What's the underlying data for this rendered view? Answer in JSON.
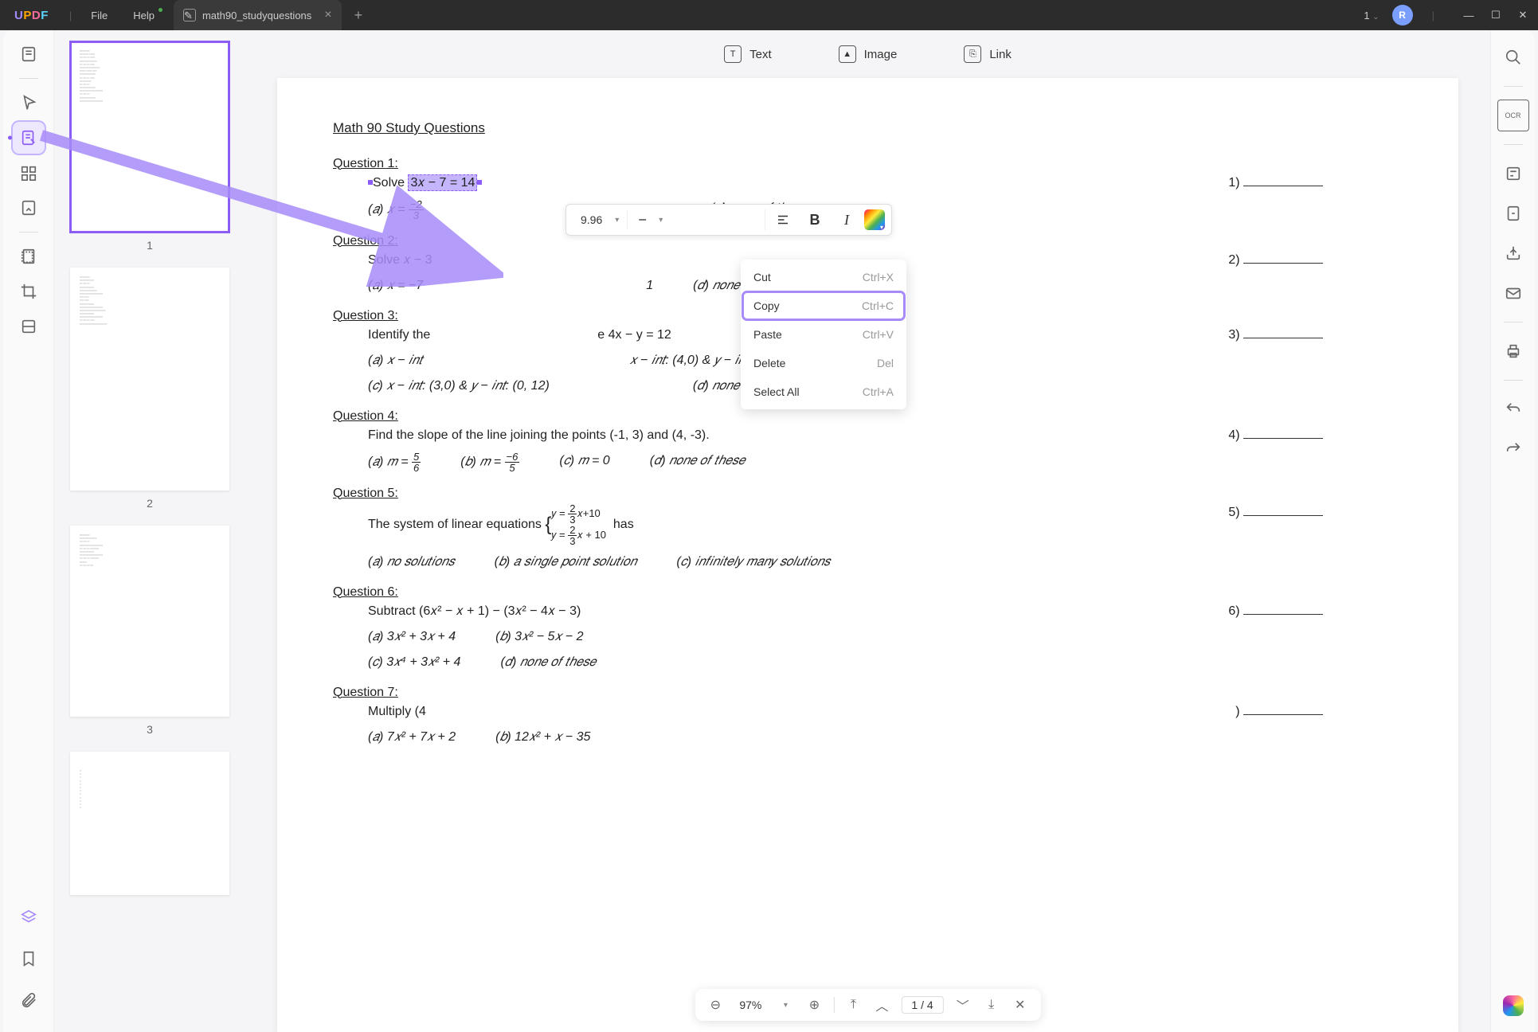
{
  "app": {
    "name": "UPDF"
  },
  "menus": {
    "file": "File",
    "help": "Help"
  },
  "tab": {
    "title": "math90_studyquestions"
  },
  "titlebar": {
    "page_indicator": "1"
  },
  "avatar": {
    "initial": "R"
  },
  "top_tools": {
    "text": "Text",
    "image": "Image",
    "link": "Link"
  },
  "edit_toolbar": {
    "font_size": "9.96",
    "font_family": "–",
    "bold": "B",
    "italic": "I"
  },
  "context_menu": {
    "items": [
      {
        "label": "Cut",
        "shortcut": "Ctrl+X"
      },
      {
        "label": "Copy",
        "shortcut": "Ctrl+C",
        "highlighted": true
      },
      {
        "label": "Paste",
        "shortcut": "Ctrl+V"
      },
      {
        "label": "Delete",
        "shortcut": "Del"
      },
      {
        "label": "Select All",
        "shortcut": "Ctrl+A"
      }
    ]
  },
  "thumbs": {
    "p1": "1",
    "p2": "2",
    "p3": "3"
  },
  "document": {
    "title": "Math 90 Study Questions",
    "q1": {
      "label": "Question 1:",
      "prompt": "Solve",
      "expr": "3𝑥 − 7 = 14",
      "num": "1)",
      "a": "(𝑎)   𝑥 = ",
      "d": "(𝑑)   𝑛𝑜𝑛𝑒 𝑜𝑓 𝑡ℎ𝑒𝑠𝑒"
    },
    "q2": {
      "label": "Question 2:",
      "prompt": "Solve  𝑥 − 3",
      "num": "2)",
      "a": "(𝑎)   𝑥 = −7",
      "bnum": "1",
      "d": "(𝑑)   𝑛𝑜𝑛𝑒 𝑜𝑓 𝑡ℎ𝑒𝑠𝑒"
    },
    "q3": {
      "label": "Question 3:",
      "prompt": "Identify the",
      "promptb": "e 4x − y = 12",
      "num": "3)",
      "a": "(𝑎)   𝑥 − 𝑖𝑛𝑡",
      "b": "𝑥 − 𝑖𝑛𝑡: (4,0) & 𝑦 − 𝑖𝑛𝑡: (0, −1)",
      "c": "(𝑐)   𝑥 − 𝑖𝑛𝑡: (3,0) & 𝑦 − 𝑖𝑛𝑡: (0, 12)",
      "d": "(𝑑)   𝑛𝑜𝑛𝑒 𝑜𝑓 𝑡ℎ𝑒𝑠𝑒"
    },
    "q4": {
      "label": "Question 4:",
      "prompt": "Find the slope of the line joining the points (-1, 3) and (4, -3).",
      "num": "4)",
      "a": "(𝑎)   𝑚 = ",
      "b": "(𝑏)   𝑚 = ",
      "c": "(𝑐)   𝑚 = 0",
      "d": "(𝑑)   𝑛𝑜𝑛𝑒 𝑜𝑓 𝑡ℎ𝑒𝑠𝑒"
    },
    "q5": {
      "label": "Question 5:",
      "prompta": "The system of linear equations",
      "promptb": "has",
      "num": "5)",
      "a": "(𝑎)   𝑛𝑜 𝑠𝑜𝑙𝑢𝑡𝑖𝑜𝑛𝑠",
      "b": "(𝑏)   𝑎 𝑠𝑖𝑛𝑔𝑙𝑒 𝑝𝑜𝑖𝑛𝑡 𝑠𝑜𝑙𝑢𝑡𝑖𝑜𝑛",
      "c": "(𝑐)   𝑖𝑛𝑓𝑖𝑛𝑖𝑡𝑒𝑙𝑦 𝑚𝑎𝑛𝑦 𝑠𝑜𝑙𝑢𝑡𝑖𝑜𝑛𝑠"
    },
    "q6": {
      "label": "Question 6:",
      "prompt": "Subtract (6𝑥² − 𝑥 + 1) − (3𝑥² − 4𝑥 − 3)",
      "num": "6)",
      "a": "(𝑎)   3𝑥² + 3𝑥 + 4",
      "b": "(𝑏)   3𝑥² − 5𝑥 − 2",
      "c": "(𝑐)   3𝑥⁴ + 3𝑥² + 4",
      "d": "(𝑑)   𝑛𝑜𝑛𝑒 𝑜𝑓 𝑡ℎ𝑒𝑠𝑒"
    },
    "q7": {
      "label": "Question 7:",
      "prompt": "Multiply (4",
      "num": ")",
      "a": "(𝑎)   7𝑥² + 7𝑥 + 2",
      "b": "(𝑏)   12𝑥² + 𝑥 − 35"
    }
  },
  "bottom_bar": {
    "zoom": "97%",
    "page": "1 / 4"
  },
  "chart_data": null
}
